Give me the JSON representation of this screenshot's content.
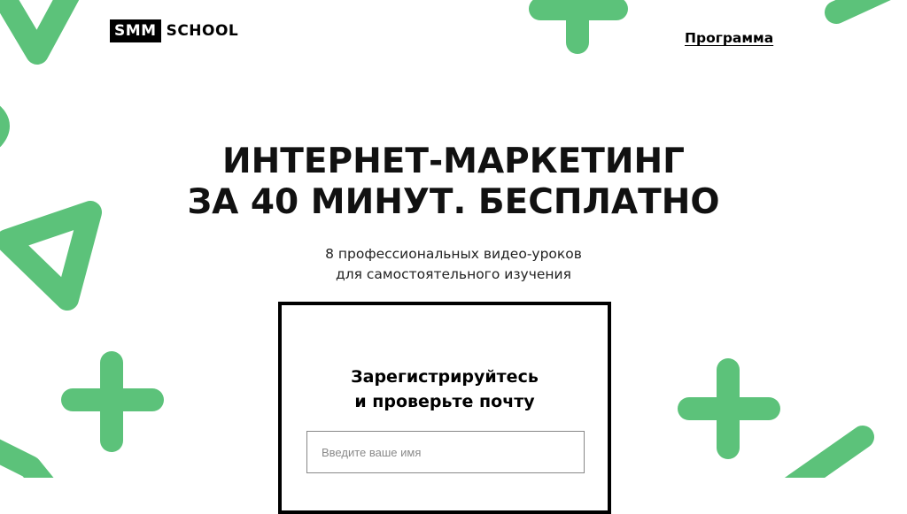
{
  "brand": {
    "logo_mark": "SMM",
    "logo_text": "SCHOOL"
  },
  "nav": {
    "program_label": "Программа"
  },
  "hero": {
    "title_lines": [
      "ИНТЕРНЕТ-МАРКЕТИНГ",
      "ЗА 40 МИНУТ. БЕСПЛАТНО"
    ],
    "subtitle_lines": [
      "8 профессиональных видео-уроков",
      "для самостоятельного изучения"
    ]
  },
  "form": {
    "title_lines": [
      "Зарегистрируйтесь",
      "и проверьте почту"
    ],
    "name_placeholder": "Введите ваше имя",
    "name_value": ""
  },
  "colors": {
    "accent_green": "#5cc27a",
    "text": "#111111",
    "background": "#ffffff"
  },
  "decorations": [
    "plus-shape",
    "triangle-shape",
    "line-shape"
  ]
}
